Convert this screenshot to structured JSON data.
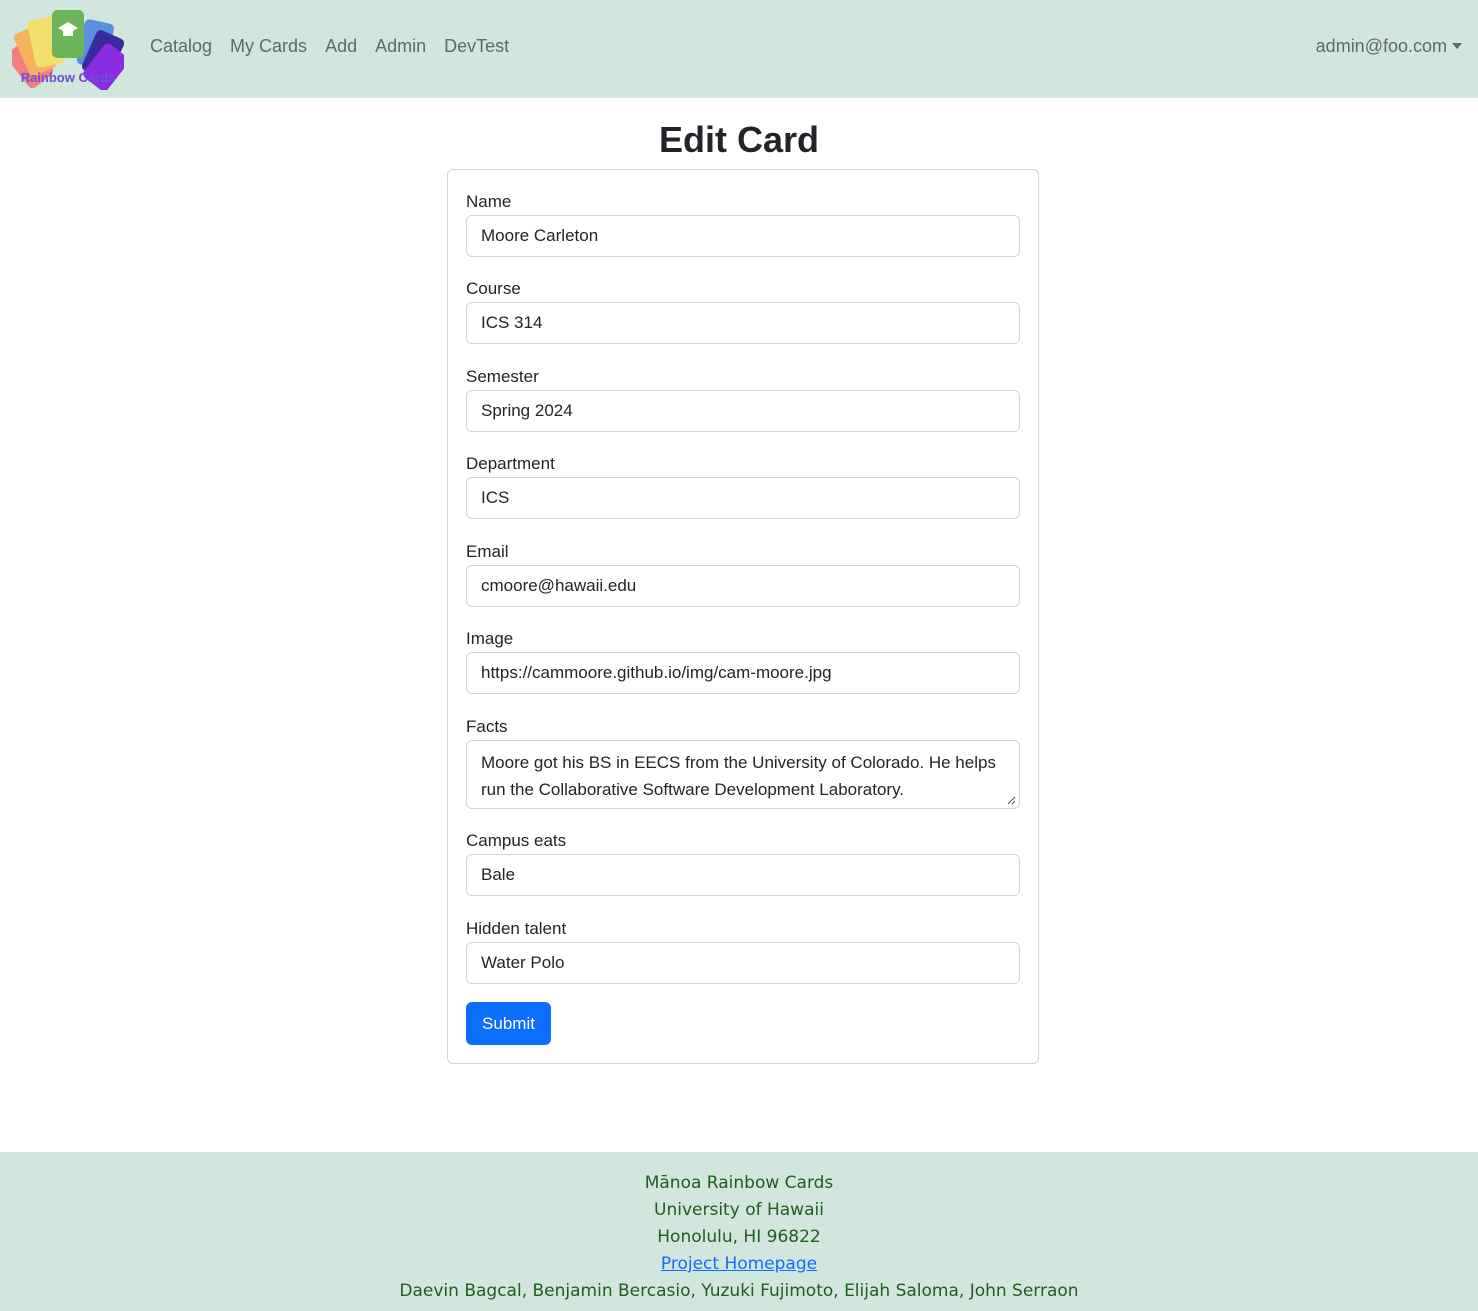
{
  "navbar": {
    "logo_text": "Rainbow Cards",
    "links": [
      "Catalog",
      "My Cards",
      "Add",
      "Admin",
      "DevTest"
    ],
    "user": "admin@foo.com"
  },
  "page": {
    "title": "Edit Card"
  },
  "form": {
    "fields": [
      {
        "label": "Name",
        "value": "Moore Carleton"
      },
      {
        "label": "Course",
        "value": "ICS 314"
      },
      {
        "label": "Semester",
        "value": "Spring 2024"
      },
      {
        "label": "Department",
        "value": "ICS"
      },
      {
        "label": "Email",
        "value": "cmoore@hawaii.edu"
      },
      {
        "label": "Image",
        "value": "https://cammoore.github.io/img/cam-moore.jpg"
      },
      {
        "label": "Facts",
        "value": "Moore got his BS in EECS from the University of Colorado. He helps run the Collaborative Software Development Laboratory."
      },
      {
        "label": "Campus eats",
        "value": "Bale"
      },
      {
        "label": "Hidden talent",
        "value": "Water Polo"
      }
    ],
    "submit_label": "Submit"
  },
  "footer": {
    "line1": "Mānoa Rainbow Cards",
    "line2": "University of Hawaii",
    "line3": "Honolulu, HI 96822",
    "link": "Project Homepage",
    "authors": "Daevin Bagcal, Benjamin Bercasio, Yuzuki Fujimoto, Elijah Saloma, John Serraon"
  },
  "colors": {
    "navbar_bg": "#d1e6dd",
    "primary": "#0d6efd",
    "footer_text": "#1e5e1e"
  }
}
